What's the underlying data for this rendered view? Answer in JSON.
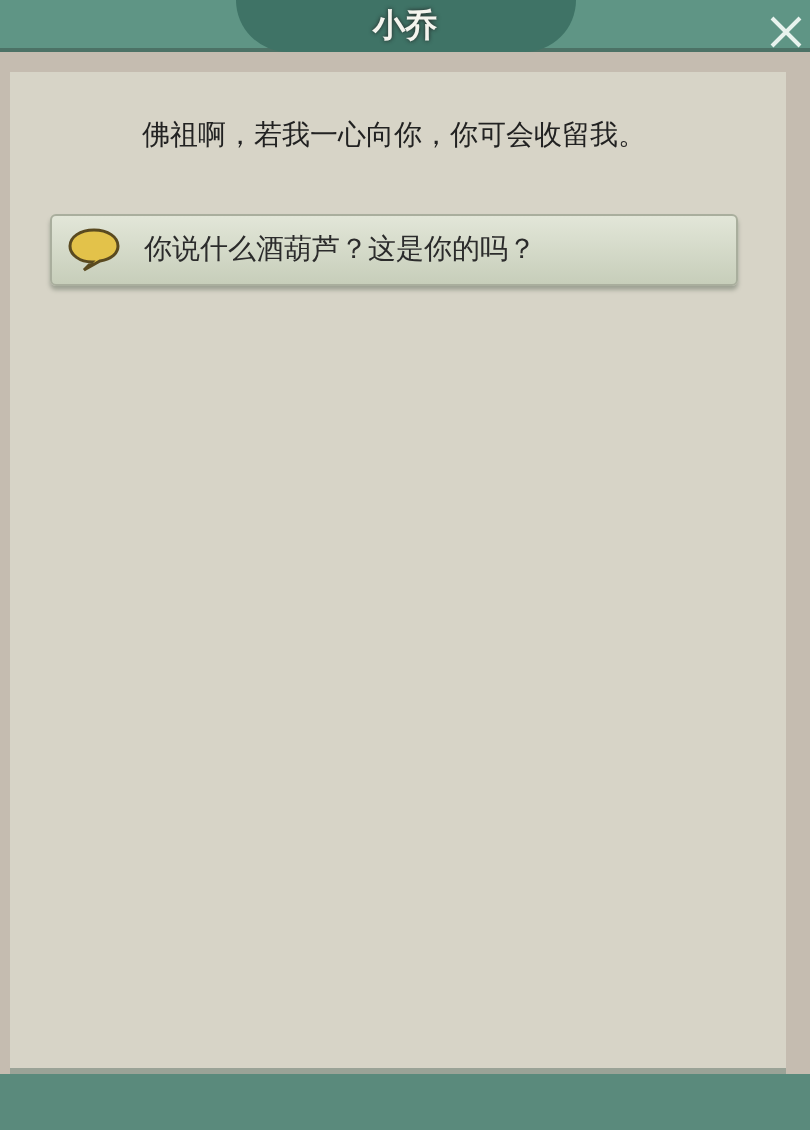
{
  "window": {
    "title": "小乔"
  },
  "dialogue": {
    "text": "佛祖啊，若我一心向你，你可会收留我。"
  },
  "options": [
    {
      "label": "你说什么酒葫芦？这是你的吗？"
    }
  ]
}
